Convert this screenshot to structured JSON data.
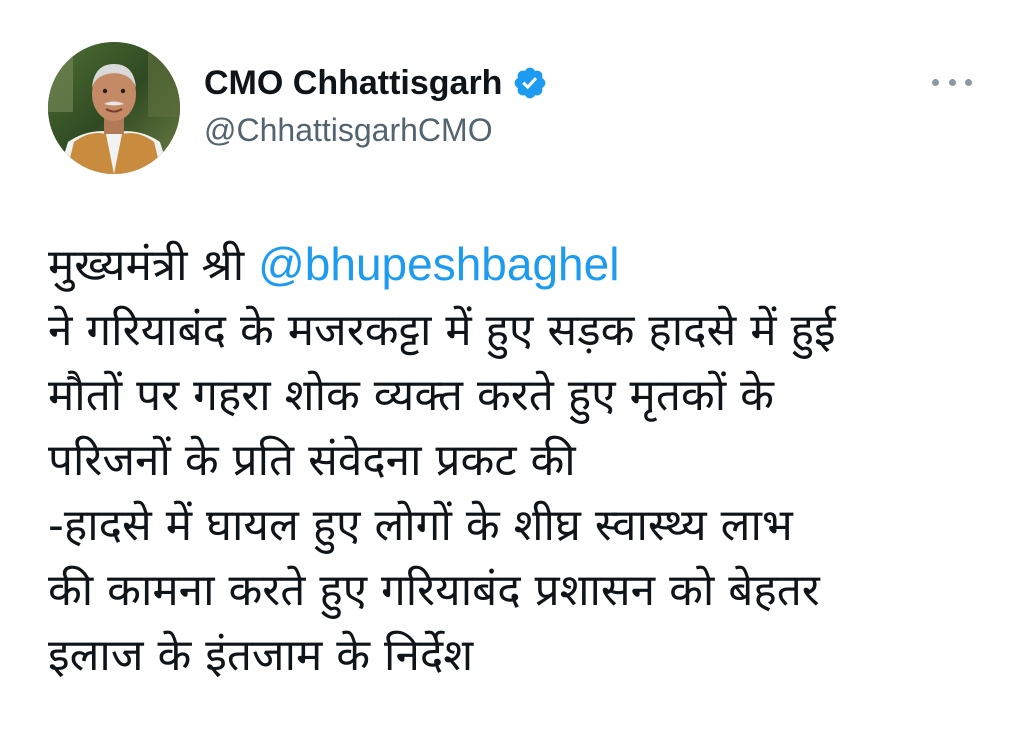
{
  "tweet": {
    "author": {
      "display_name": "CMO Chhattisgarh",
      "handle": "@ChhattisgarhCMO",
      "verified": true
    },
    "more_icon": "more-horizontal-icon",
    "text": {
      "line1_prefix": "मुख्यमंत्री श्री ",
      "mention": "@bhupeshbaghel",
      "line2": "ने गरियाबंद के मजरकट्टा में हुए सड़क हादसे में हुई",
      "line3": "मौतों पर गहरा शोक व्यक्त करते हुए मृतकों के",
      "line4": "परिजनों के प्रति संवेदना प्रकट की",
      "line5": "-हादसे में घायल हुए लोगों के शीघ्र स्वास्थ्य लाभ",
      "line6": "की कामना करते हुए गरियाबंद प्रशासन को बेहतर",
      "line7": "इलाज के इंतजाम के निर्देश"
    }
  },
  "colors": {
    "text": "#0f1419",
    "secondary": "#536471",
    "accent": "#1d9bf0",
    "background": "#ffffff"
  }
}
